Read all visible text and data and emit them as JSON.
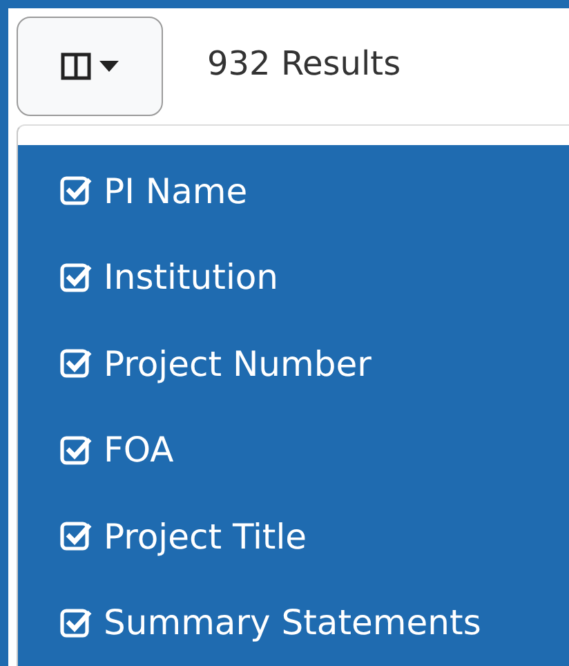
{
  "toolbar": {
    "results_count": "932 Results"
  },
  "column_menu": {
    "items": [
      {
        "label": "PI Name",
        "checked": true
      },
      {
        "label": "Institution",
        "checked": true
      },
      {
        "label": "Project Number",
        "checked": true
      },
      {
        "label": "FOA",
        "checked": true
      },
      {
        "label": "Project Title",
        "checked": true
      },
      {
        "label": "Summary Statements",
        "checked": true
      }
    ]
  }
}
